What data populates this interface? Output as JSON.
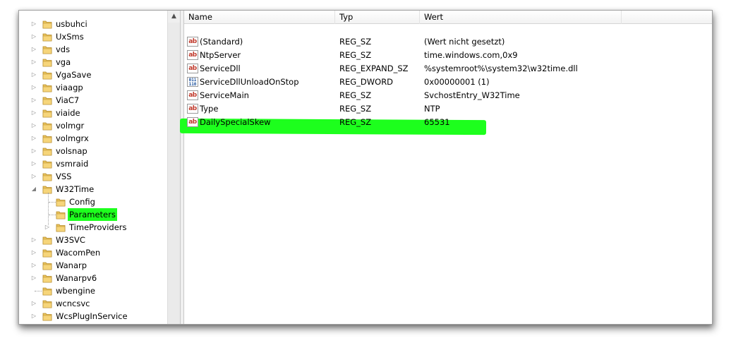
{
  "tree": {
    "items": [
      {
        "label": "usbuhci",
        "expander": "▷"
      },
      {
        "label": "UxSms",
        "expander": "▷"
      },
      {
        "label": "vds",
        "expander": "▷"
      },
      {
        "label": "vga",
        "expander": "▷"
      },
      {
        "label": "VgaSave",
        "expander": "▷"
      },
      {
        "label": "viaagp",
        "expander": "▷"
      },
      {
        "label": "ViaC7",
        "expander": "▷"
      },
      {
        "label": "viaide",
        "expander": "▷"
      },
      {
        "label": "volmgr",
        "expander": "▷"
      },
      {
        "label": "volmgrx",
        "expander": "▷"
      },
      {
        "label": "volsnap",
        "expander": "▷"
      },
      {
        "label": "vsmraid",
        "expander": "▷"
      },
      {
        "label": "VSS",
        "expander": "▷"
      },
      {
        "label": "W32Time",
        "expander": "◢"
      },
      {
        "label": "Config",
        "expander": ""
      },
      {
        "label": "Parameters",
        "expander": ""
      },
      {
        "label": "TimeProviders",
        "expander": "▷"
      },
      {
        "label": "W3SVC",
        "expander": "▷"
      },
      {
        "label": "WacomPen",
        "expander": "▷"
      },
      {
        "label": "Wanarp",
        "expander": "▷"
      },
      {
        "label": "Wanarpv6",
        "expander": "▷"
      },
      {
        "label": "wbengine",
        "expander": ""
      },
      {
        "label": "wcncsvc",
        "expander": "▷"
      },
      {
        "label": "WcsPlugInService",
        "expander": "▷"
      }
    ],
    "scroll_up": "▲"
  },
  "list": {
    "columns": {
      "name": "Name",
      "type": "Typ",
      "value": "Wert"
    },
    "rows": [
      {
        "icon": "ab",
        "name": "(Standard)",
        "type": "REG_SZ",
        "value": "(Wert nicht gesetzt)"
      },
      {
        "icon": "ab",
        "name": "NtpServer",
        "type": "REG_SZ",
        "value": "time.windows.com,0x9"
      },
      {
        "icon": "ab",
        "name": "ServiceDll",
        "type": "REG_EXPAND_SZ",
        "value": "%systemroot%\\system32\\w32time.dll"
      },
      {
        "icon": "011\n110",
        "name": "ServiceDllUnloadOnStop",
        "type": "REG_DWORD",
        "value": "0x00000001 (1)"
      },
      {
        "icon": "ab",
        "name": "ServiceMain",
        "type": "REG_SZ",
        "value": "SvchostEntry_W32Time"
      },
      {
        "icon": "ab",
        "name": "Type",
        "type": "REG_SZ",
        "value": "NTP"
      },
      {
        "icon": "ab",
        "name": "DailySpecialSkew",
        "type": "REG_SZ",
        "value": "65531"
      }
    ]
  },
  "colors": {
    "highlight": "#1dff1d",
    "folder": "#e8c25a"
  }
}
